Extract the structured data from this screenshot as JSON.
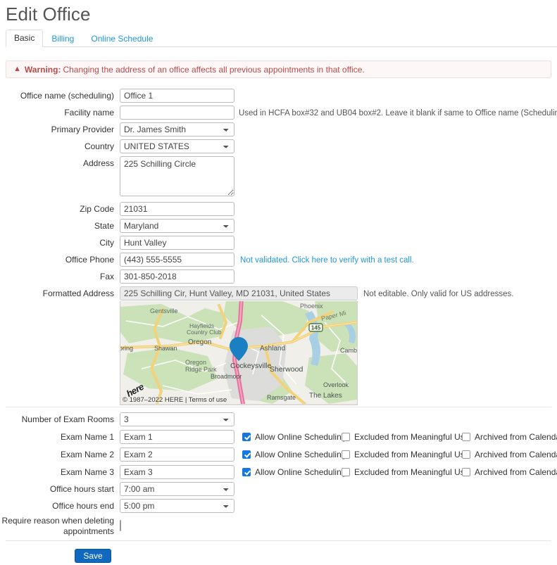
{
  "header": {
    "title": "Edit Office"
  },
  "tabs": [
    {
      "label": "Basic",
      "active": true
    },
    {
      "label": "Billing",
      "active": false
    },
    {
      "label": "Online Schedule",
      "active": false
    }
  ],
  "warning": {
    "icon": "warning-triangle-icon",
    "strong": "Warning:",
    "text": "Changing the address of an office affects all previous appointments in that office."
  },
  "basic_section": {
    "office_name": {
      "label": "Office name (scheduling)",
      "value": "Office 1"
    },
    "facility_name": {
      "label": "Facility name",
      "value": "",
      "hint": "Used in HCFA box#32 and UB04 box#2. Leave it blank if same to Office name (Scheduling)"
    },
    "primary_provider": {
      "label": "Primary Provider",
      "value": "Dr. James Smith"
    },
    "country": {
      "label": "Country",
      "value": "UNITED STATES"
    },
    "address": {
      "label": "Address",
      "value": "225 Schilling Circle"
    },
    "zip_code": {
      "label": "Zip Code",
      "value": "21031"
    },
    "state": {
      "label": "State",
      "value": "Maryland"
    },
    "city": {
      "label": "City",
      "value": "Hunt Valley"
    },
    "office_phone": {
      "label": "Office Phone",
      "value": "(443) 555-5555",
      "hint": "Not validated. Click here to verify with a test call."
    },
    "fax": {
      "label": "Fax",
      "value": "301-850-2018"
    },
    "formatted_address": {
      "label": "Formatted Address",
      "value": "225 Schilling Cir, Hunt Valley, MD 21031, United States",
      "hint": "Not editable. Only valid for US addresses."
    }
  },
  "map": {
    "attribution": "© 1987–2022 HERE | Terms of use",
    "logo": "here",
    "marker": "location-pin-icon",
    "labels": [
      "Gentsville",
      "Hayfields Country Club",
      "Phoenix",
      "Paper Mill",
      "Oregon",
      "Shawan",
      "pring",
      "Ashland",
      "145",
      "Oregon Ridge Park",
      "Cockeysville",
      "Sherwood",
      "Camb",
      "Broadmoor",
      "Overlook",
      "The Lakes",
      "Ramsgate"
    ]
  },
  "rooms_section": {
    "number_of_exam_rooms": {
      "label": "Number of Exam Rooms",
      "value": "3"
    },
    "exam_rooms": [
      {
        "label": "Exam Name 1",
        "value": "Exam 1",
        "allow_online_scheduling": {
          "label": "Allow Online Scheduling",
          "checked": true
        },
        "excluded_from_meaningful_use": {
          "label": "Excluded from Meaningful Use",
          "checked": false
        },
        "archived_from_calendar": {
          "label": "Archived from Calendar",
          "checked": false
        }
      },
      {
        "label": "Exam Name 2",
        "value": "Exam 2",
        "allow_online_scheduling": {
          "label": "Allow Online Scheduling",
          "checked": true
        },
        "excluded_from_meaningful_use": {
          "label": "Excluded from Meaningful Use",
          "checked": false
        },
        "archived_from_calendar": {
          "label": "Archived from Calendar",
          "checked": false
        }
      },
      {
        "label": "Exam Name 3",
        "value": "Exam 3",
        "allow_online_scheduling": {
          "label": "Allow Online Scheduling",
          "checked": true
        },
        "excluded_from_meaningful_use": {
          "label": "Excluded from Meaningful Use",
          "checked": false
        },
        "archived_from_calendar": {
          "label": "Archived from Calendar",
          "checked": false
        }
      }
    ],
    "office_hours_start": {
      "label": "Office hours start",
      "value": "7:00 am"
    },
    "office_hours_end": {
      "label": "Office hours end",
      "value": "5:00 pm"
    },
    "require_reason": {
      "label_line1": "Require reason when deleting",
      "label_line2": "appointments",
      "checked": false
    }
  },
  "footer": {
    "save_label": "Save"
  },
  "colors": {
    "link": "#2196dd",
    "warning_text": "#b94a48",
    "warning_bg": "#fdf7f7",
    "checkbox_on": "#1577e0",
    "primary_button": "#1068bf",
    "map_pin": "#1b7fc4"
  }
}
